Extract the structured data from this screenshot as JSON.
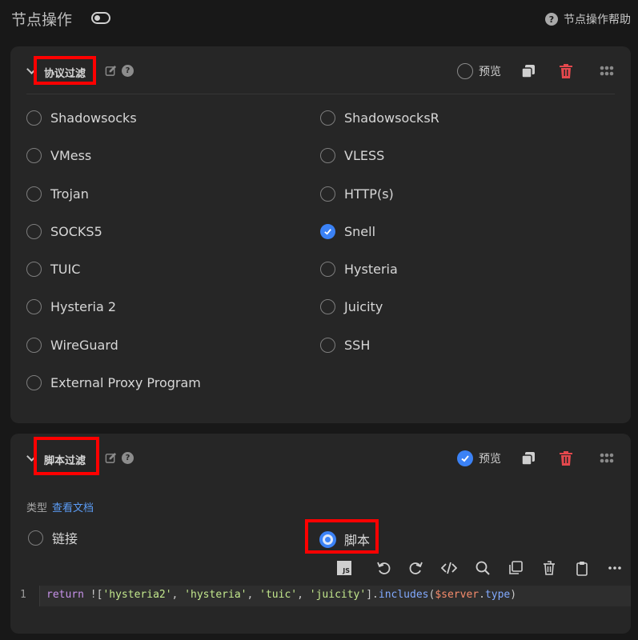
{
  "header": {
    "title": "节点操作",
    "help_label": "节点操作帮助"
  },
  "protocol_card": {
    "title": "协议过滤",
    "preview_label": "预览",
    "preview_checked": false,
    "options": [
      {
        "label": "Shadowsocks",
        "checked": false
      },
      {
        "label": "ShadowsocksR",
        "checked": false
      },
      {
        "label": "VMess",
        "checked": false
      },
      {
        "label": "VLESS",
        "checked": false
      },
      {
        "label": "Trojan",
        "checked": false
      },
      {
        "label": "HTTP(s)",
        "checked": false
      },
      {
        "label": "SOCKS5",
        "checked": false
      },
      {
        "label": "Snell",
        "checked": true
      },
      {
        "label": "TUIC",
        "checked": false
      },
      {
        "label": "Hysteria",
        "checked": false
      },
      {
        "label": "Hysteria 2",
        "checked": false
      },
      {
        "label": "Juicity",
        "checked": false
      },
      {
        "label": "WireGuard",
        "checked": false
      },
      {
        "label": "SSH",
        "checked": false
      },
      {
        "label": "External Proxy Program",
        "checked": false
      }
    ]
  },
  "script_card": {
    "title": "脚本过滤",
    "preview_label": "预览",
    "preview_checked": true,
    "type_label": "类型",
    "docs_link": "查看文档",
    "mode_link": "链接",
    "mode_script": "脚本",
    "selected_mode": "脚本",
    "editor": {
      "line_number": "1",
      "tokens": {
        "t1": "return",
        "t2": " ![",
        "t3": "'hysteria2'",
        "t4": ", ",
        "t5": "'hysteria'",
        "t6": ", ",
        "t7": "'tuic'",
        "t8": ", ",
        "t9": "'juicity'",
        "t10": "].",
        "t11": "includes",
        "t12": "(",
        "t13": "$server",
        "t14": ".",
        "t15": "type",
        "t16": ")"
      }
    }
  },
  "colors": {
    "accent": "#3b82f6",
    "danger": "#e5484d",
    "highlight": "#ff0000"
  }
}
